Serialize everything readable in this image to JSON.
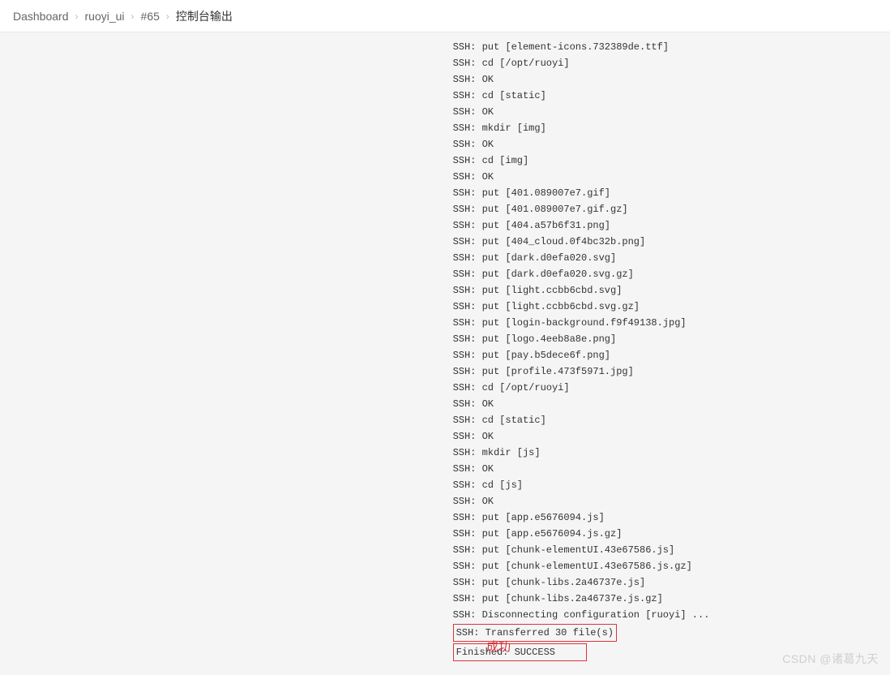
{
  "breadcrumb": {
    "items": [
      "Dashboard",
      "ruoyi_ui",
      "#65",
      "控制台输出"
    ]
  },
  "console": {
    "lines": [
      "SSH: put [element-icons.732389de.ttf]",
      "SSH: cd [/opt/ruoyi]",
      "SSH: OK",
      "SSH: cd [static]",
      "SSH: OK",
      "SSH: mkdir [img]",
      "SSH: OK",
      "SSH: cd [img]",
      "SSH: OK",
      "SSH: put [401.089007e7.gif]",
      "SSH: put [401.089007e7.gif.gz]",
      "SSH: put [404.a57b6f31.png]",
      "SSH: put [404_cloud.0f4bc32b.png]",
      "SSH: put [dark.d0efa020.svg]",
      "SSH: put [dark.d0efa020.svg.gz]",
      "SSH: put [light.ccbb6cbd.svg]",
      "SSH: put [light.ccbb6cbd.svg.gz]",
      "SSH: put [login-background.f9f49138.jpg]",
      "SSH: put [logo.4eeb8a8e.png]",
      "SSH: put [pay.b5dece6f.png]",
      "SSH: put [profile.473f5971.jpg]",
      "SSH: cd [/opt/ruoyi]",
      "SSH: OK",
      "SSH: cd [static]",
      "SSH: OK",
      "SSH: mkdir [js]",
      "SSH: OK",
      "SSH: cd [js]",
      "SSH: OK",
      "SSH: put [app.e5676094.js]",
      "SSH: put [app.e5676094.js.gz]",
      "SSH: put [chunk-elementUI.43e67586.js]",
      "SSH: put [chunk-elementUI.43e67586.js.gz]",
      "SSH: put [chunk-libs.2a46737e.js]",
      "SSH: put [chunk-libs.2a46737e.js.gz]",
      "SSH: Disconnecting configuration [ruoyi] ..."
    ],
    "highlighted": [
      "SSH: Transferred 30 file(s)",
      "Finished: SUCCESS"
    ]
  },
  "annotation": "成功",
  "watermark": "CSDN @诸葛九天"
}
